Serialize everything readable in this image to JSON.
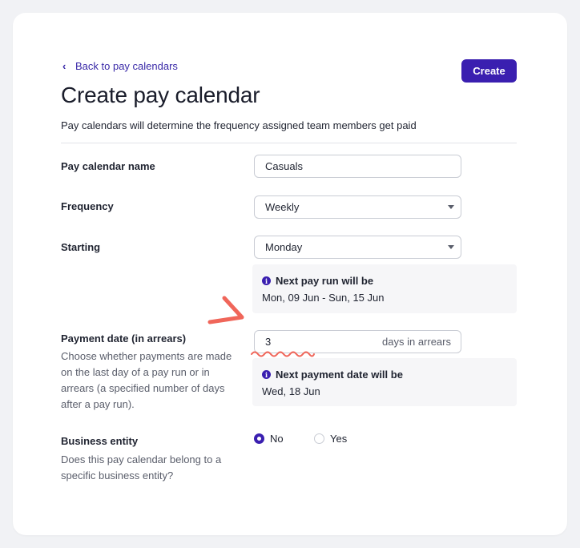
{
  "header": {
    "back_label": "Back to pay calendars",
    "title": "Create pay calendar",
    "subtitle": "Pay calendars will determine the frequency assigned team members get paid",
    "create_label": "Create"
  },
  "form": {
    "name": {
      "label": "Pay calendar name",
      "value": "Casuals"
    },
    "frequency": {
      "label": "Frequency",
      "value": "Weekly"
    },
    "starting": {
      "label": "Starting",
      "value": "Monday"
    },
    "next_pay_run": {
      "heading": "Next pay run will be",
      "value": "Mon, 09 Jun - Sun, 15 Jun"
    },
    "payment_date": {
      "label": "Payment date (in arrears)",
      "description": "Choose whether payments are made on the last day of a pay run or in arrears (a specified number of days after a pay run).",
      "value": "3",
      "suffix": "days in arrears"
    },
    "next_payment": {
      "heading": "Next payment date will be",
      "value": "Wed, 18 Jun"
    },
    "business_entity": {
      "label": "Business entity",
      "description": "Does this pay calendar belong to a specific business entity?",
      "options": [
        "No",
        "Yes"
      ],
      "selected": "No"
    }
  },
  "icons": {
    "back": "chevron-left-icon",
    "dropdown": "caret-down-icon",
    "info": "info-icon"
  },
  "colors": {
    "accent": "#3a1fb0",
    "annotation": "#f0665a"
  }
}
